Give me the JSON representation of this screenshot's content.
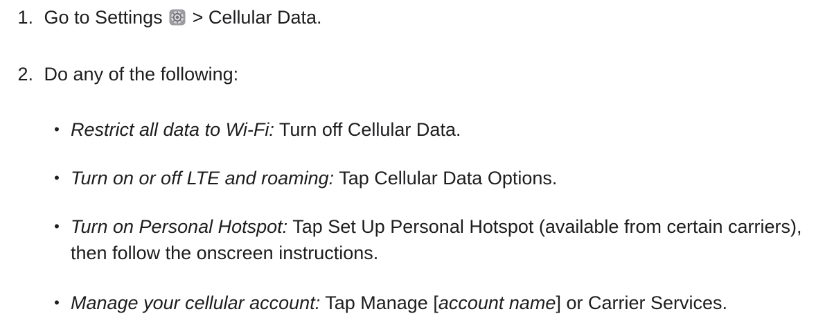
{
  "steps": [
    {
      "number": "1.",
      "before_icon": "Go to Settings",
      "icon": "settings-gear-icon",
      "after_icon": "> Cellular Data."
    },
    {
      "number": "2.",
      "text": "Do any of the following:"
    }
  ],
  "bullets": [
    {
      "lead": "Restrict all data to Wi-Fi:",
      "body": "Turn off Cellular Data."
    },
    {
      "lead": "Turn on or off LTE and roaming:",
      "body": "Tap Cellular Data Options."
    },
    {
      "lead": "Turn on Personal Hotspot:",
      "body": "Tap Set Up Personal Hotspot (available from certain carriers), then follow the onscreen instructions."
    },
    {
      "lead": "Manage your cellular account:",
      "body_pre": "Tap Manage [",
      "body_em": "account name",
      "body_post": "] or Carrier Services."
    }
  ],
  "colors": {
    "text": "#1d1d1f",
    "background": "#ffffff",
    "icon_gray": "#8e8e93"
  }
}
